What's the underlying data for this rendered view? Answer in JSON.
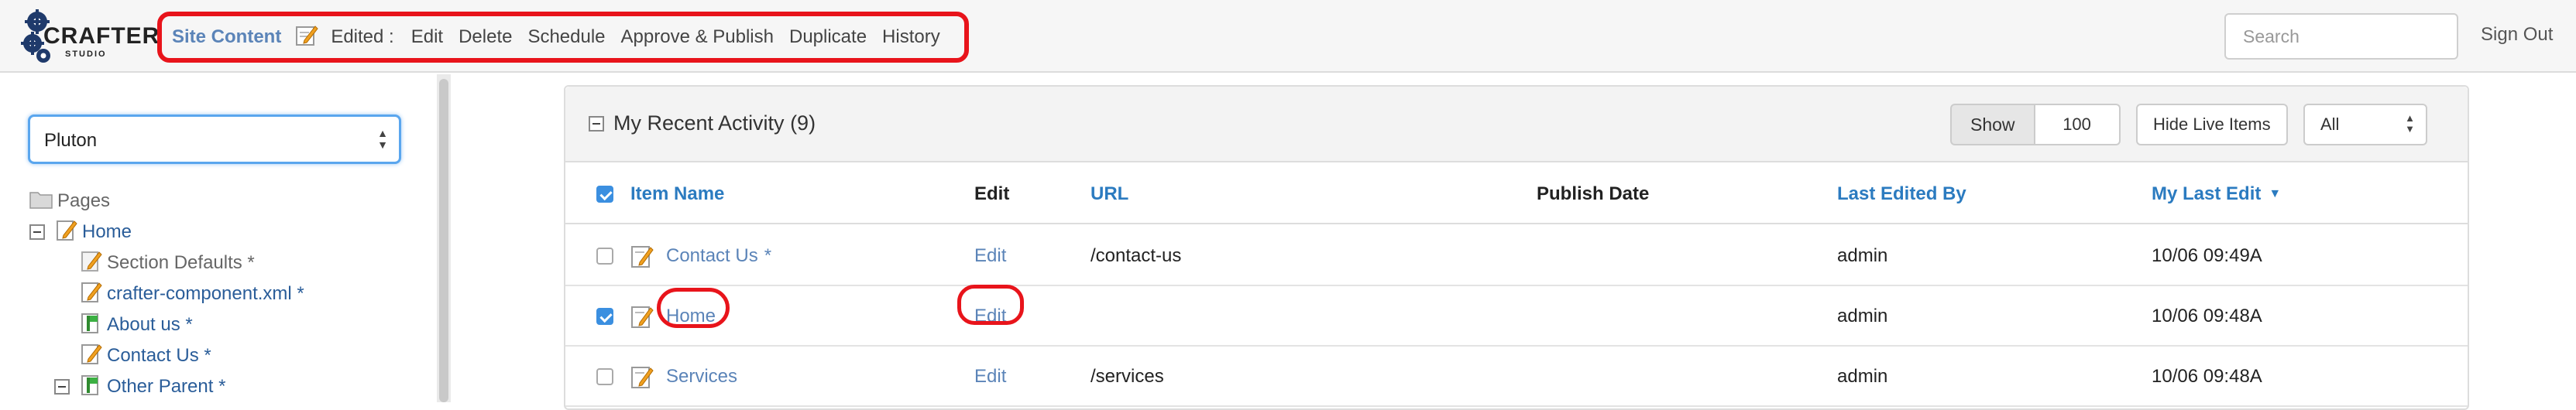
{
  "brand": {
    "name": "CRAFTER",
    "sub": "STUDIO"
  },
  "nav": {
    "site_content": "Site Content",
    "edited_label": "Edited :",
    "actions": [
      "Edit",
      "Delete",
      "Schedule",
      "Approve & Publish",
      "Duplicate",
      "History"
    ]
  },
  "search": {
    "placeholder": "Search"
  },
  "sign_out": "Sign Out",
  "sidebar": {
    "site_value": "Pluton",
    "tree": [
      {
        "label": "Pages",
        "icon": "folder-icon"
      },
      {
        "label": "Home",
        "icon": "page-edit-icon"
      },
      {
        "label": "Section Defaults *",
        "icon": "component-edit-icon"
      },
      {
        "label": "crafter-component.xml *",
        "icon": "page-edit-icon"
      },
      {
        "label": "About us *",
        "icon": "page-flag-icon"
      },
      {
        "label": "Contact Us *",
        "icon": "page-edit-icon"
      },
      {
        "label": "Other Parent *",
        "icon": "page-flag-icon"
      }
    ]
  },
  "panel": {
    "title": "My Recent Activity (9)",
    "show_label": "Show",
    "show_value": "100",
    "hide_live": "Hide Live Items",
    "filter_value": "All",
    "headers": {
      "item_name": "Item Name",
      "edit": "Edit",
      "url": "URL",
      "publish_date": "Publish Date",
      "last_edited_by": "Last Edited By",
      "my_last_edit": "My Last Edit"
    },
    "rows": [
      {
        "checked": false,
        "name": "Contact Us",
        "star": "*",
        "edit": "Edit",
        "url": "/contact-us",
        "publish_date": "",
        "editor": "admin",
        "date": "10/06 09:49A"
      },
      {
        "checked": true,
        "name": "Home",
        "star": "",
        "edit": "Edit",
        "url": "",
        "publish_date": "",
        "editor": "admin",
        "date": "10/06 09:48A"
      },
      {
        "checked": false,
        "name": "Services",
        "star": "",
        "edit": "Edit",
        "url": "/services",
        "publish_date": "",
        "editor": "admin",
        "date": "10/06 09:48A"
      }
    ]
  },
  "colors": {
    "link": "#5b84b8",
    "header_link": "#2b7bc0",
    "highlight": "#e8141b",
    "checkbox": "#3b8fe0"
  }
}
